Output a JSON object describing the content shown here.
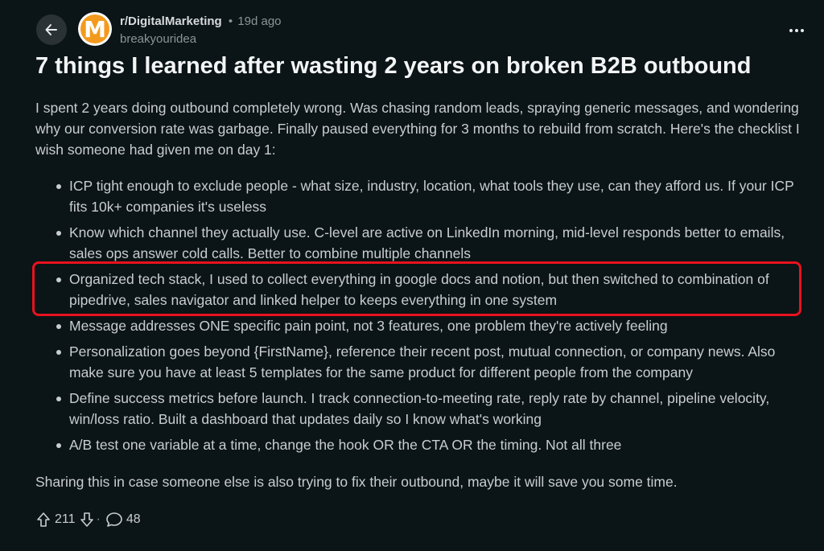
{
  "header": {
    "subreddit": "r/DigitalMarketing",
    "separator": "•",
    "age": "19d ago",
    "author": "breakyouridea",
    "avatar_letter": "M"
  },
  "post": {
    "title": "7 things I learned after wasting 2 years on broken B2B outbound",
    "intro": "I spent 2 years doing outbound completely wrong. Was chasing random leads, spraying generic messages, and wondering why our conversion rate was garbage. Finally paused everything for 3 months to rebuild from scratch. Here's the checklist I wish someone had given me on day 1:",
    "bullets": [
      "ICP tight enough to exclude people - what size, industry, location, what tools they use, can they afford us. If your ICP fits 10k+ companies it's useless",
      "Know which channel they actually use. C-level are active on LinkedIn morning, mid-level responds better to emails, sales ops answer cold calls. Better to combine multiple channels",
      "Organized tech stack, I used to collect everything in google docs and notion, but then switched to combination of pipedrive, sales navigator and linked helper to keeps everything in one system",
      "Message addresses ONE specific pain point, not 3 features, one problem they're actively feeling",
      "Personalization goes beyond {FirstName}, reference their recent post, mutual connection, or company news. Also make sure you have at least 5 templates for the same product for different people from the company",
      "Define success metrics before launch. I track connection-to-meeting rate, reply rate by channel, pipeline velocity, win/loss ratio. Built a dashboard that updates daily so I know what's working",
      "A/B test one variable at a time, change the hook OR the CTA OR the timing. Not all three"
    ],
    "outro": "Sharing this in case someone else is also trying to fix their outbound, maybe it will save you some time."
  },
  "actions": {
    "upvotes": "211",
    "separator": "·",
    "comments": "48"
  },
  "colors": {
    "background": "#0b1416",
    "highlight": "#e8121f",
    "avatar": "#f39a1e"
  },
  "icons": {
    "back": "arrow-left-icon",
    "more": "more-horizontal-icon",
    "upvote": "arrow-up-icon",
    "downvote": "arrow-down-icon",
    "comment": "comment-bubble-icon"
  }
}
